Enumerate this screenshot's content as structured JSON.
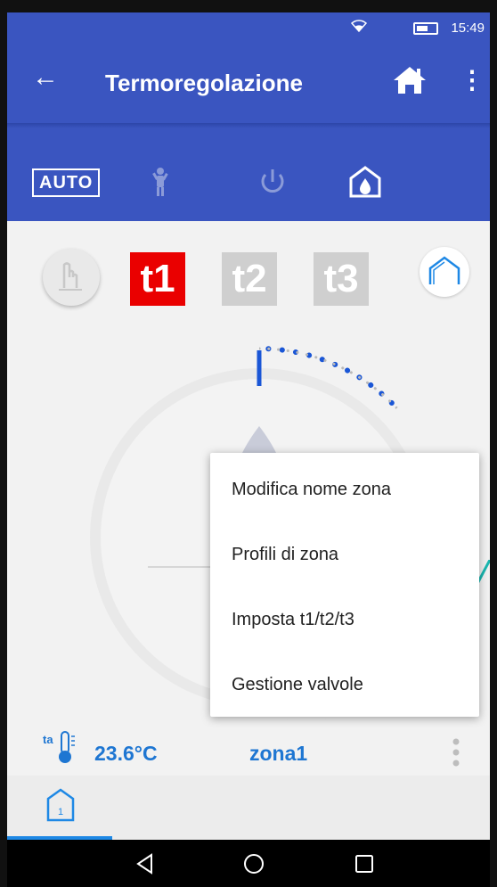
{
  "status_bar": {
    "time": "15:49"
  },
  "app_bar": {
    "title": "Termoregolazione"
  },
  "mode_bar": {
    "auto_label": "AUTO"
  },
  "setpoints": {
    "t1": "t1",
    "t2": "t2",
    "t3": "t3"
  },
  "zone_info": {
    "temp_icon_label": "ta",
    "temperature": "23.6°C",
    "zone_name": "zona1"
  },
  "context_menu": {
    "items": [
      "Modifica nome zona",
      "Profili di zona",
      "Imposta t1/t2/t3",
      "Gestione valvole"
    ]
  },
  "tabs": [
    {
      "badge": "1"
    }
  ],
  "colors": {
    "primary": "#3a55c0",
    "t1_active": "#ea0000",
    "dial_blue": "#1a56d6",
    "text_blue": "#1e76d2",
    "annotation": "#1ab7b0"
  }
}
